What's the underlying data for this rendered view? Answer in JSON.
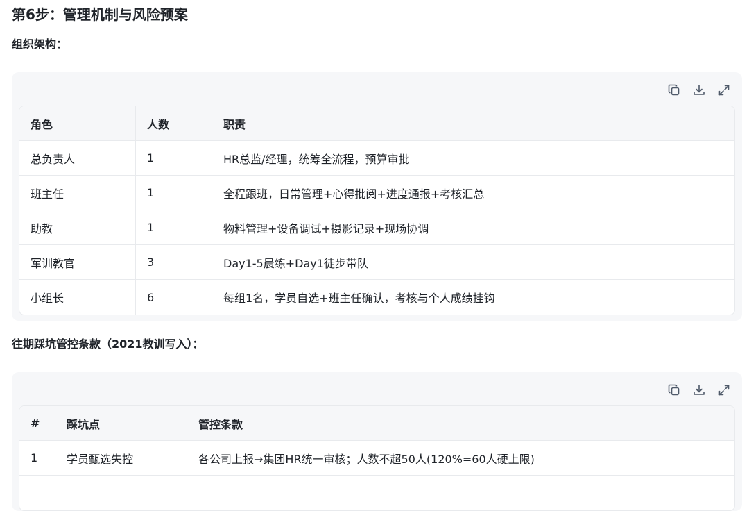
{
  "step_title": "第6步：管理机制与风险预案",
  "org_heading": "组织架构：",
  "org_table": {
    "headers": [
      "角色",
      "人数",
      "职责"
    ],
    "rows": [
      [
        "总负责人",
        "1",
        "HR总监/经理，统筹全流程，预算审批"
      ],
      [
        "班主任",
        "1",
        "全程跟班，日常管理+心得批阅+进度通报+考核汇总"
      ],
      [
        "助教",
        "1",
        "物料管理+设备调试+摄影记录+现场协调"
      ],
      [
        "军训教官",
        "3",
        "Day1-5晨练+Day1徒步带队"
      ],
      [
        "小组长",
        "6",
        "每组1名，学员自选+班主任确认，考核与个人成绩挂钩"
      ]
    ]
  },
  "pitfall_heading": "往期踩坑管控条款（2021教训写入）：",
  "pitfall_table": {
    "headers": [
      "#",
      "踩坑点",
      "管控条款"
    ],
    "rows": [
      [
        "1",
        "学员甄选失控",
        "各公司上报→集团HR统一审核；人数不超50人(120%=60人硬上限)"
      ],
      [
        "",
        "",
        ""
      ]
    ]
  },
  "toolbar": {
    "icons": [
      "copy-icon",
      "download-icon",
      "expand-icon"
    ]
  },
  "colors": {
    "text": "#1f2329",
    "card_bg": "#f6f7f9",
    "border": "#e8eaed",
    "icon": "#4e5969"
  }
}
